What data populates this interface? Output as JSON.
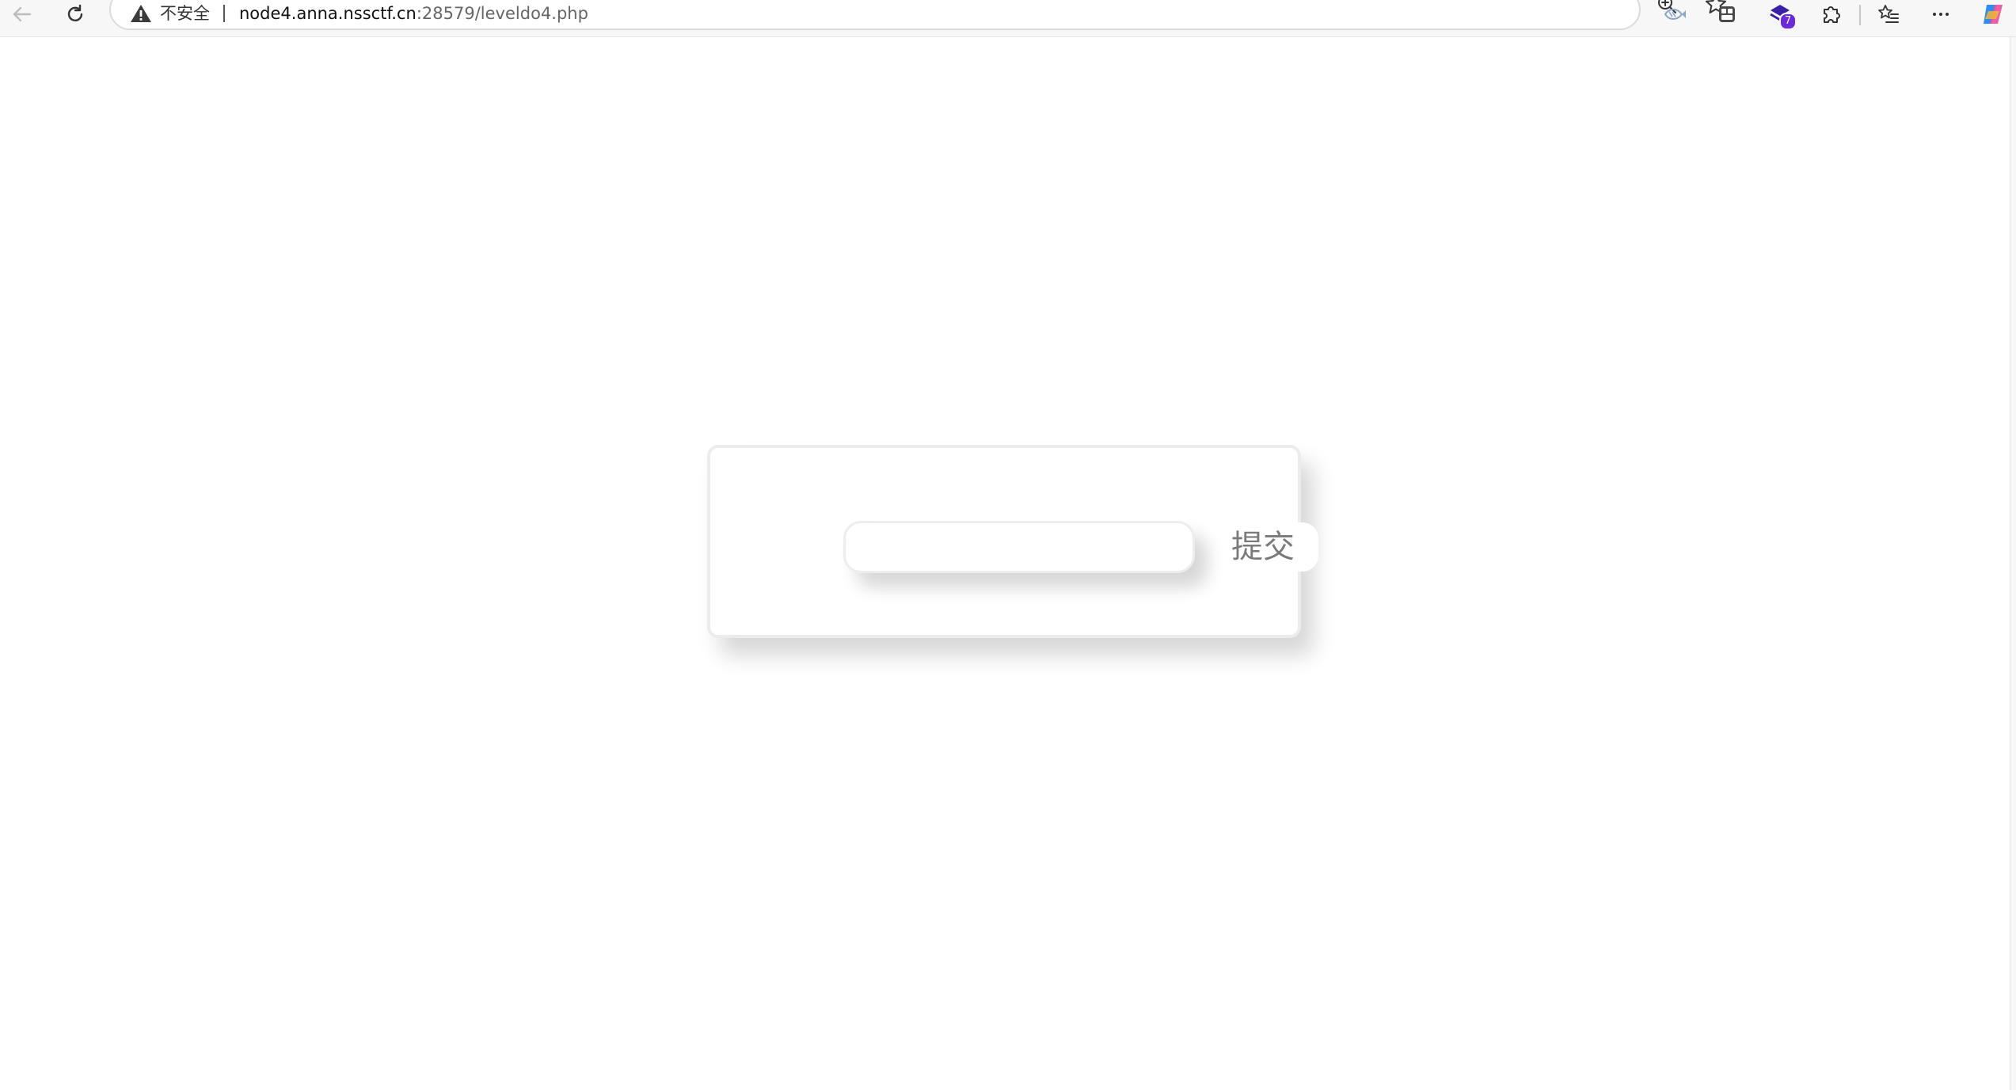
{
  "browser": {
    "security_label": "不安全",
    "url_host": "node4.anna.nssctf.cn",
    "url_rest": ":28579/leveldo4.php",
    "extension_badge_count": "7",
    "icons": {
      "back": "arrow-left-icon",
      "reload": "reload-icon",
      "insecure": "warning-triangle-icon",
      "zoom": "zoom-in-icon",
      "favorite": "star-icon",
      "extensions": [
        "fish-extension-icon",
        "tabs-extension-icon",
        "stack-extension-icon",
        "puzzle-icon",
        "favorites-list-icon",
        "more-icon",
        "copilot-icon"
      ]
    }
  },
  "form": {
    "input_value": "",
    "submit_label": "提交"
  },
  "colors": {
    "toolbar_bg": "#f7f7f7",
    "card_border": "#ececec",
    "button_text": "#7a7a7a",
    "badge": "#6b2bd9"
  }
}
